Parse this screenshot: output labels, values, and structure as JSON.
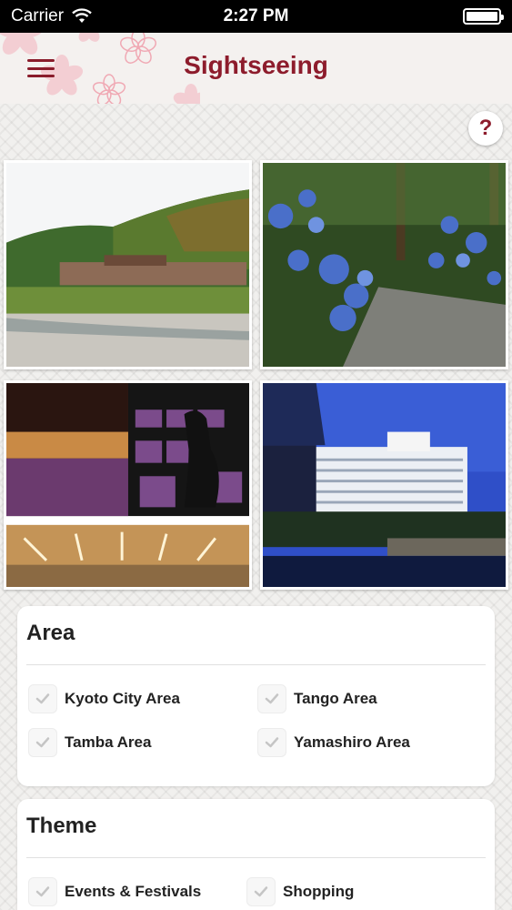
{
  "status_bar": {
    "carrier": "Carrier",
    "time": "2:27 PM",
    "battery_level": 1.0
  },
  "header": {
    "title": "Sightseeing",
    "menu_icon": "hamburger-menu-icon",
    "accent_color": "#8d1c2c"
  },
  "help": {
    "label": "?"
  },
  "gallery": [
    {
      "name": "photo-riverside-village"
    },
    {
      "name": "photo-hydrangea-path"
    },
    {
      "name": "photo-lit-exhibition-hall"
    },
    {
      "name": "photo-hotel-by-castle"
    }
  ],
  "area": {
    "title": "Area",
    "options": [
      {
        "label": "Kyoto City Area",
        "checked": false
      },
      {
        "label": "Tango Area",
        "checked": false
      },
      {
        "label": "Tamba Area",
        "checked": false
      },
      {
        "label": "Yamashiro Area",
        "checked": false
      }
    ]
  },
  "theme": {
    "title": "Theme",
    "options": [
      {
        "label": "Events & Festivals",
        "checked": false
      },
      {
        "label": "Shopping",
        "checked": false
      }
    ]
  }
}
